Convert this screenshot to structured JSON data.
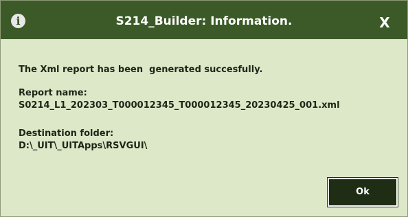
{
  "window": {
    "title": "S214_Builder: Information.",
    "info_icon_glyph": "i",
    "close_label": "X"
  },
  "message": {
    "status": "The Xml report has been  generated succesfully.",
    "report_name_label": "Report name:",
    "report_name_value": "S0214_L1_202303_T000012345_T000012345_20230425_001.xml",
    "destination_label": "Destination folder:",
    "destination_value": "D:\\_UIT\\_UITApps\\RSVGUI\\"
  },
  "buttons": {
    "ok_label": "Ok"
  },
  "colors": {
    "titlebar": "#3b5a27",
    "body": "#dde8c9",
    "button": "#1f2d14"
  }
}
